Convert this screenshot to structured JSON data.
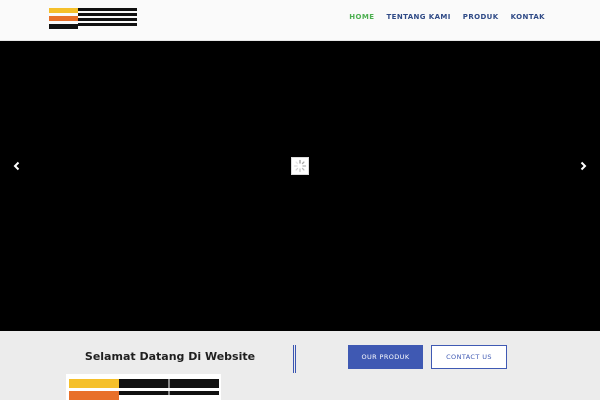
{
  "nav": {
    "items": [
      {
        "label": "HOME",
        "active": true
      },
      {
        "label": "TENTANG KAMI",
        "active": false
      },
      {
        "label": "PRODUK",
        "active": false
      },
      {
        "label": "KONTAK",
        "active": false
      }
    ]
  },
  "slider": {
    "prev_icon": "chevron-left-icon",
    "next_icon": "chevron-right-icon",
    "loader_icon": "spinner-icon"
  },
  "welcome": {
    "title": "Selamat Datang Di Website",
    "primary_button": "OUR PRODUK",
    "secondary_button": "CONTACT US"
  },
  "colors": {
    "logo_yellow": "#f5c02a",
    "logo_orange": "#e8702a",
    "logo_black": "#111111",
    "nav_active": "#4caf50",
    "nav_text": "#2f4a86",
    "accent_blue": "#3f59b3"
  }
}
